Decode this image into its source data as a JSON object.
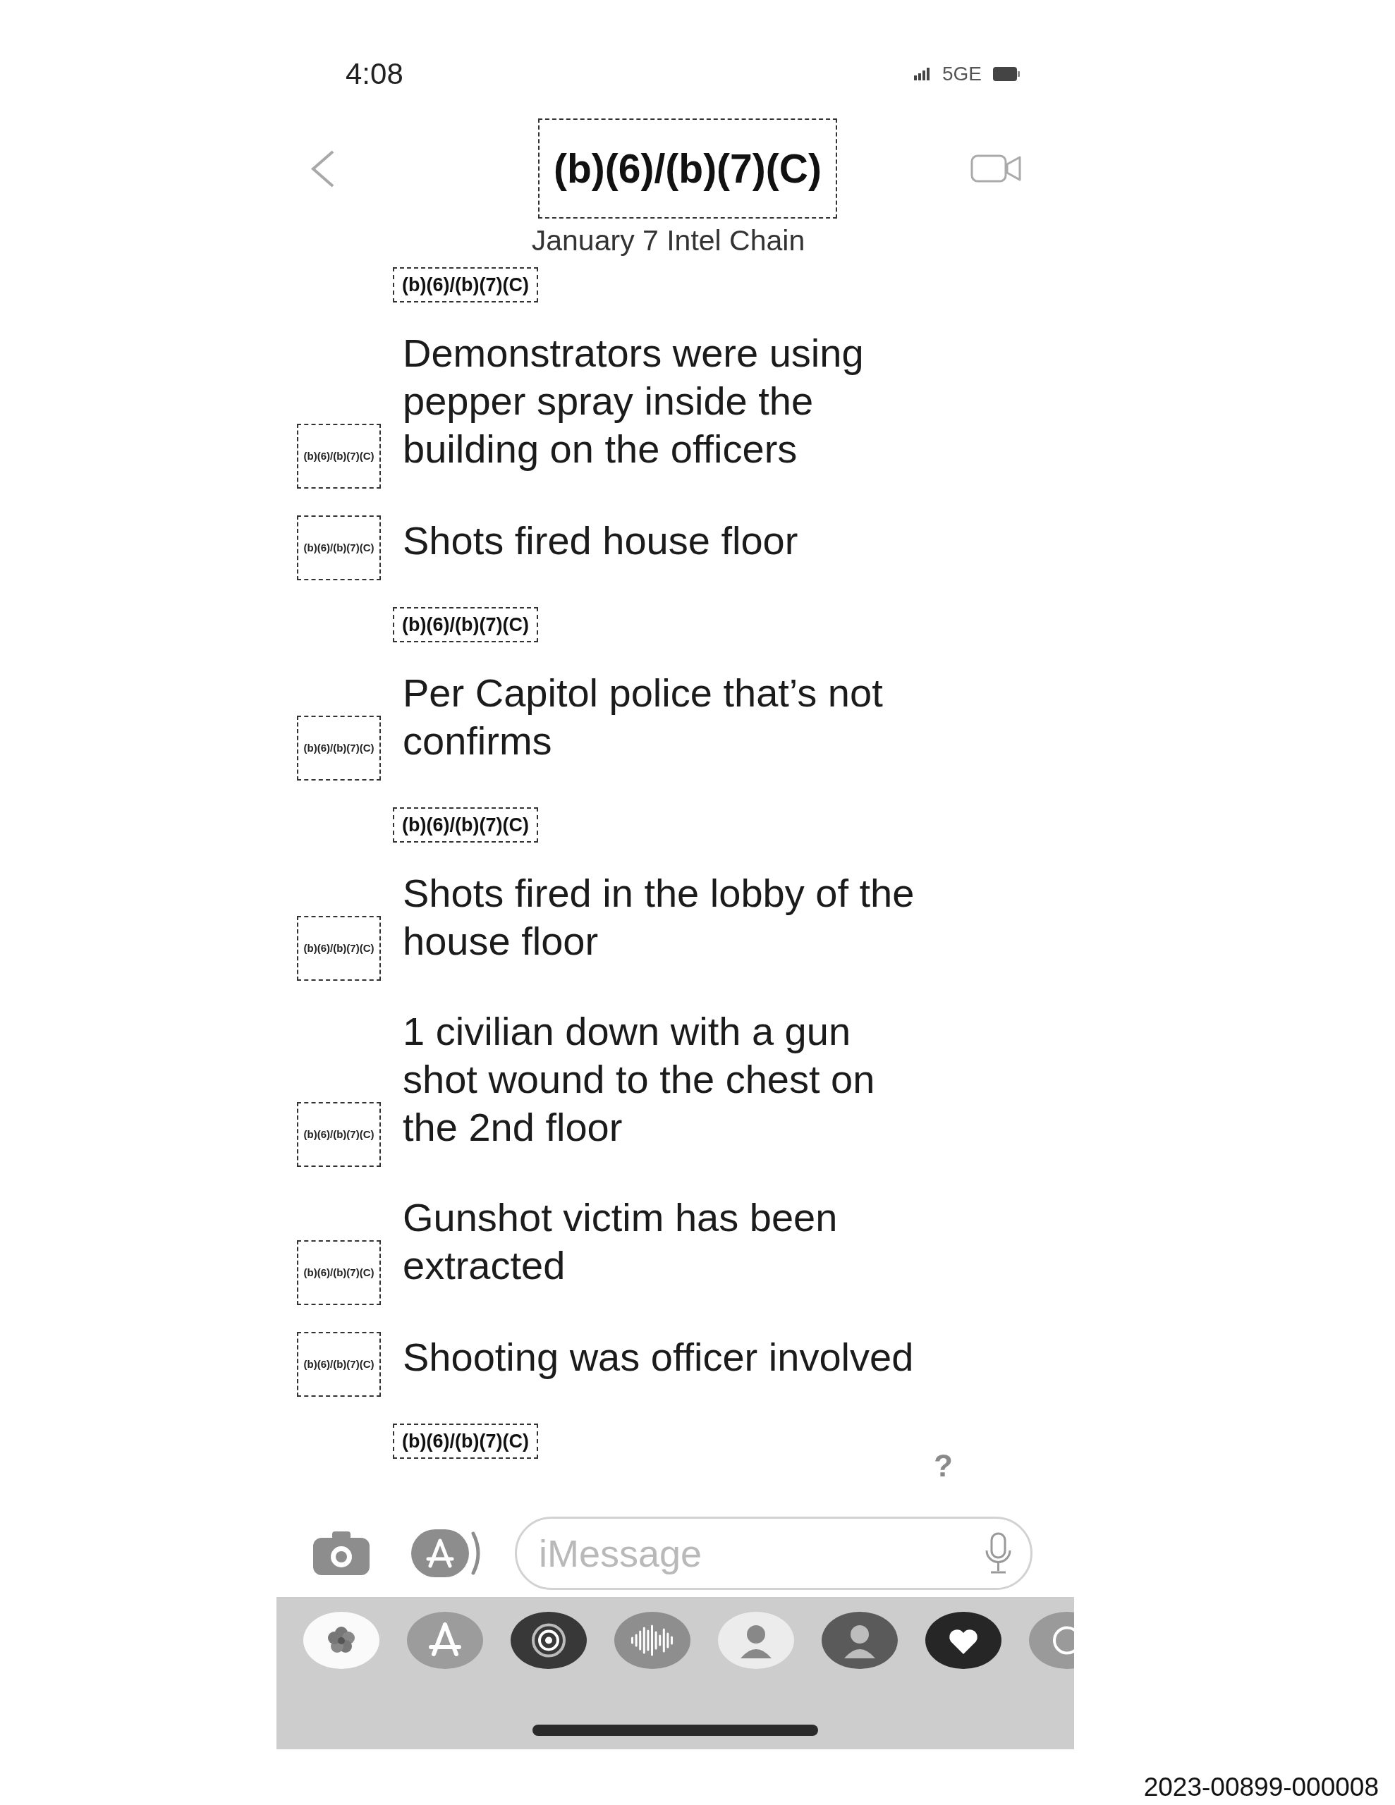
{
  "status_bar": {
    "time": "4:08",
    "network": "5GE"
  },
  "header": {
    "title": "(b)(6)/(b)(7)(C)",
    "subtitle": "January 7 Intel Chain"
  },
  "messages": [
    {
      "kind": "sender",
      "text": "(b)(6)/(b)(7)(C)"
    },
    {
      "kind": "message",
      "avatar": "(b)(6)/(b)(7)(C)",
      "text": "Demonstrators were using pepper spray inside the building on the officers"
    },
    {
      "kind": "message",
      "avatar": "(b)(6)/(b)(7)(C)",
      "text": "Shots fired house floor"
    },
    {
      "kind": "sender",
      "text": "(b)(6)/(b)(7)(C)"
    },
    {
      "kind": "message",
      "avatar": "(b)(6)/(b)(7)(C)",
      "text": "Per Capitol police that’s not confirms"
    },
    {
      "kind": "sender",
      "text": "(b)(6)/(b)(7)(C)"
    },
    {
      "kind": "message",
      "avatar": "(b)(6)/(b)(7)(C)",
      "text": "Shots fired in the lobby of the house floor"
    },
    {
      "kind": "message",
      "avatar": "(b)(6)/(b)(7)(C)",
      "text": "1 civilian down with a gun shot wound to the chest on the 2nd floor"
    },
    {
      "kind": "message",
      "avatar": "(b)(6)/(b)(7)(C)",
      "text": "Gunshot victim has been extracted"
    },
    {
      "kind": "message",
      "avatar": "(b)(6)/(b)(7)(C)",
      "text": "Shooting was officer involved"
    },
    {
      "kind": "sender",
      "text": "(b)(6)/(b)(7)(C)"
    },
    {
      "kind": "reaction",
      "text": "?"
    }
  ],
  "composer": {
    "placeholder": "iMessage"
  },
  "footer": {
    "document_id": "2023-00899-000008"
  }
}
